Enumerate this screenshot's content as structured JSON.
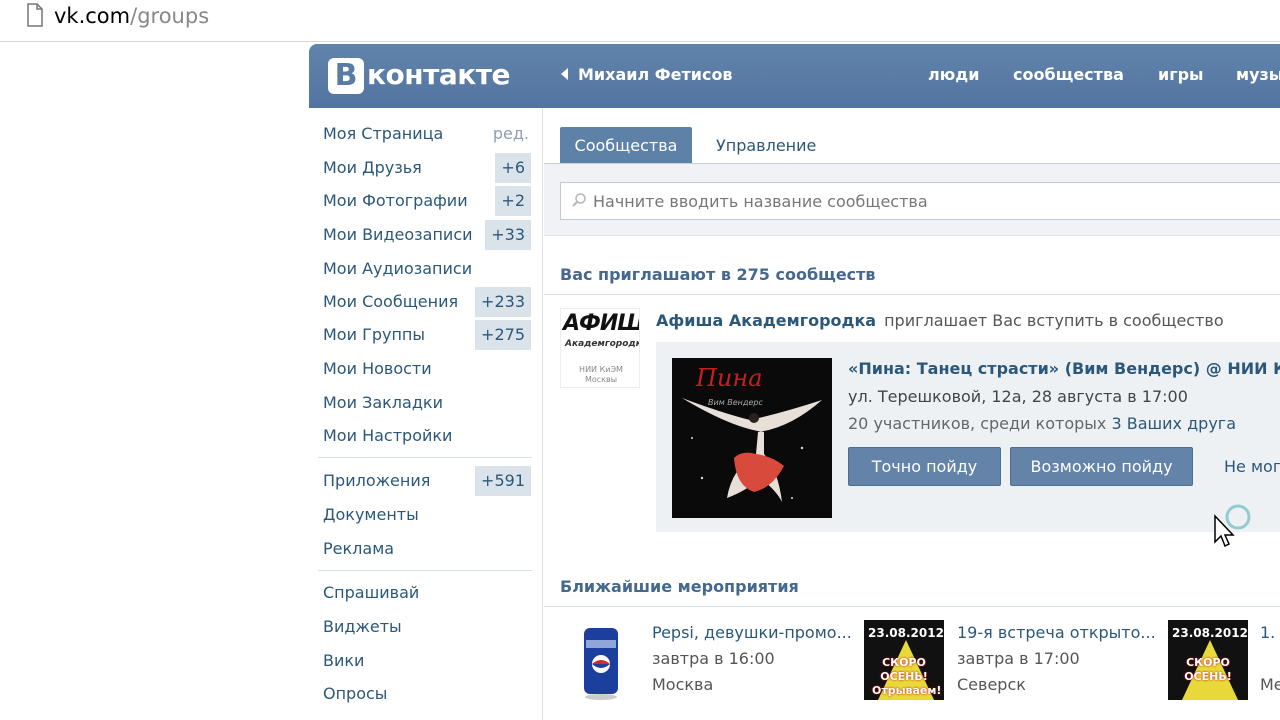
{
  "browser": {
    "url_host": "vk.com",
    "url_path": "/groups"
  },
  "header": {
    "logo_letter": "B",
    "logo_text": "контакте",
    "user_name": "Михаил Фетисов",
    "nav": [
      "люди",
      "сообщества",
      "игры",
      "музы"
    ]
  },
  "left_menu": {
    "edit_label": "ред.",
    "items": [
      {
        "label": "Моя Страница",
        "badge": ""
      },
      {
        "label": "Мои Друзья",
        "badge": "+6"
      },
      {
        "label": "Мои Фотографии",
        "badge": "+2"
      },
      {
        "label": "Мои Видеозаписи",
        "badge": "+33"
      },
      {
        "label": "Мои Аудиозаписи",
        "badge": ""
      },
      {
        "label": "Мои Сообщения",
        "badge": "+233"
      },
      {
        "label": "Мои Группы",
        "badge": "+275"
      },
      {
        "label": "Мои Новости",
        "badge": ""
      },
      {
        "label": "Мои Закладки",
        "badge": ""
      },
      {
        "label": "Мои Настройки",
        "badge": ""
      }
    ],
    "items2": [
      {
        "label": "Приложения",
        "badge": "+591"
      },
      {
        "label": "Документы",
        "badge": ""
      },
      {
        "label": "Реклама",
        "badge": ""
      }
    ],
    "items3": [
      {
        "label": "Спрашивай"
      },
      {
        "label": "Виджеты"
      },
      {
        "label": "Вики"
      },
      {
        "label": "Опросы"
      }
    ]
  },
  "tabs": {
    "communities": "Сообщества",
    "management": "Управление"
  },
  "search": {
    "placeholder": "Начните вводить название сообщества"
  },
  "invites": {
    "title": "Вас приглашают в 275 сообществ",
    "group_thumb": {
      "line1": "АФИША",
      "line2": "Академгородка",
      "line3": "НИИ КиЭМ Москвы"
    },
    "group_name": "Афиша Академгородка",
    "invite_text": "приглашает Вас вступить в сообщество",
    "event": {
      "poster_title": "Пина",
      "poster_sub": "Вим Вендерс",
      "title": "«Пина: Танец страсти» (Вим Вендерс) @ НИИ К",
      "place": "ул. Терешковой, 12а, 28 августа в 17:00",
      "members_text": "20 участников, среди которых ",
      "friends_text": "3 Ваших друга",
      "btn_going": "Точно пойду",
      "btn_maybe": "Возможно пойду",
      "btn_no": "Не могу"
    }
  },
  "upcoming": {
    "title": "Ближайшие мероприятия",
    "items": [
      {
        "title": "Pepsi, девушки-промо...",
        "time": "завтра в 16:00",
        "city": "Москва",
        "poster": {
          "date": "",
          "text": ""
        }
      },
      {
        "title": "19-я встреча открыто...",
        "time": "завтра в 17:00",
        "city": "Северск",
        "poster": {
          "date": "23.08.2012",
          "text": "СКОРО ОСЕНЬ! Отрываем!"
        }
      },
      {
        "title": "1.",
        "time": "",
        "city": "Ме",
        "poster": {
          "date": "23.08.2012",
          "text": "СКОРО ОСЕНЬ!"
        }
      }
    ]
  },
  "colors": {
    "header_bg": "#5c7fa6",
    "link": "#2b587a",
    "badge_bg": "#dae2ea",
    "button_bg": "#6383a8"
  }
}
